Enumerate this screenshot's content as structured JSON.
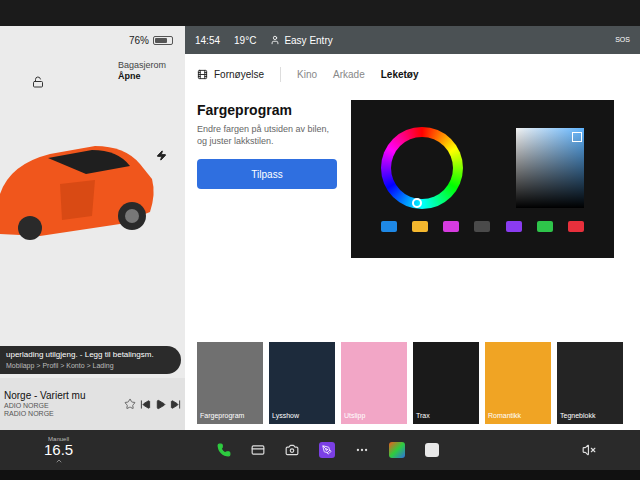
{
  "status_bar": {
    "battery": "76%",
    "battery_level": 0.76,
    "time": "14:54",
    "temperature": "19°C",
    "profile": "Easy Entry",
    "sos": "SOS"
  },
  "car": {
    "trunk_label": "Bagasjerom",
    "trunk_state": "Åpne",
    "locked": false,
    "color": "#f0561c"
  },
  "notification": {
    "line1": "uperlading utilgjeng. - Legg til betalingsm.",
    "line2": "Mobilapp > Profil > Konto > Lading"
  },
  "media": {
    "title": "Norge - Variert mu",
    "subtitle": "ADIO NORGE",
    "source": "RADIO NORGE",
    "favorite": false
  },
  "section": {
    "title": "Fornøyelse"
  },
  "tabs": [
    {
      "label": "Kino",
      "selected": false
    },
    {
      "label": "Arkade",
      "selected": false
    },
    {
      "label": "Leketøy",
      "selected": true
    }
  ],
  "feature": {
    "title": "Fargeprogram",
    "description": "Endre fargen på utsiden av bilen, og juster lakkstilen.",
    "button": "Tilpass"
  },
  "swatches": [
    {
      "color": "#1e88e5"
    },
    {
      "color": "#f5b82e"
    },
    {
      "color": "#d63be0"
    },
    {
      "color": "#4a4a4a"
    },
    {
      "color": "#8a3cf0"
    },
    {
      "color": "#2ec44a"
    },
    {
      "color": "#e8303c"
    }
  ],
  "tiles": [
    {
      "label": "Fargeprogram",
      "color": "#707070"
    },
    {
      "label": "Lysshow",
      "color": "#1d2b3c"
    },
    {
      "label": "Utslipp",
      "color": "#f2a6c6"
    },
    {
      "label": "Trax",
      "color": "#1a1a1a"
    },
    {
      "label": "Romantikk",
      "color": "#f0a424"
    },
    {
      "label": "Tegneblokk",
      "color": "#242424"
    }
  ],
  "dock": {
    "climate_mode": "Manuell",
    "temperature": "16.5",
    "muted": true
  }
}
